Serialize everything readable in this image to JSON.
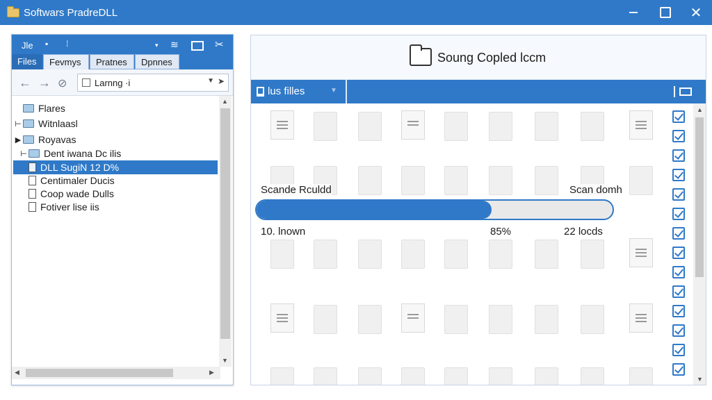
{
  "window": {
    "title": "Softwars PradreDLL"
  },
  "left_panel": {
    "menu_label": "Jle",
    "tabs": [
      "Files",
      "Fevmys",
      "Pratnes",
      "Dpnnes"
    ],
    "address": {
      "value": "Larnng ·i"
    },
    "tree": [
      {
        "label": "Flares",
        "type": "folder",
        "selected": false
      },
      {
        "label": "Witnlaasl",
        "type": "folder",
        "selected": false
      },
      {
        "label": "Royavas",
        "type": "folder",
        "selected": false
      },
      {
        "label": "Dent iwana Dc ilis",
        "type": "folder",
        "selected": false
      },
      {
        "label": "DLL SugiN 12 D%",
        "type": "doc",
        "selected": true
      },
      {
        "label": "Centimaler Ducis",
        "type": "doc",
        "selected": false
      },
      {
        "label": "Coop wade Dulls",
        "type": "doc",
        "selected": false
      },
      {
        "label": "Fotiver lise iis",
        "type": "doc",
        "selected": false
      }
    ]
  },
  "right_panel": {
    "header_title": "Soung Copled lccm",
    "toolbar_label": "lus filles",
    "progress": {
      "left_label": "Scande Rculdd",
      "right_label": "Scan domh",
      "left_count": "10. lnown",
      "percent_text": "85%",
      "right_count": "22 locds",
      "value": 0.66
    },
    "checked_count": 14
  },
  "colors": {
    "accent": "#2f79c8",
    "selection": "#2f79c8"
  }
}
